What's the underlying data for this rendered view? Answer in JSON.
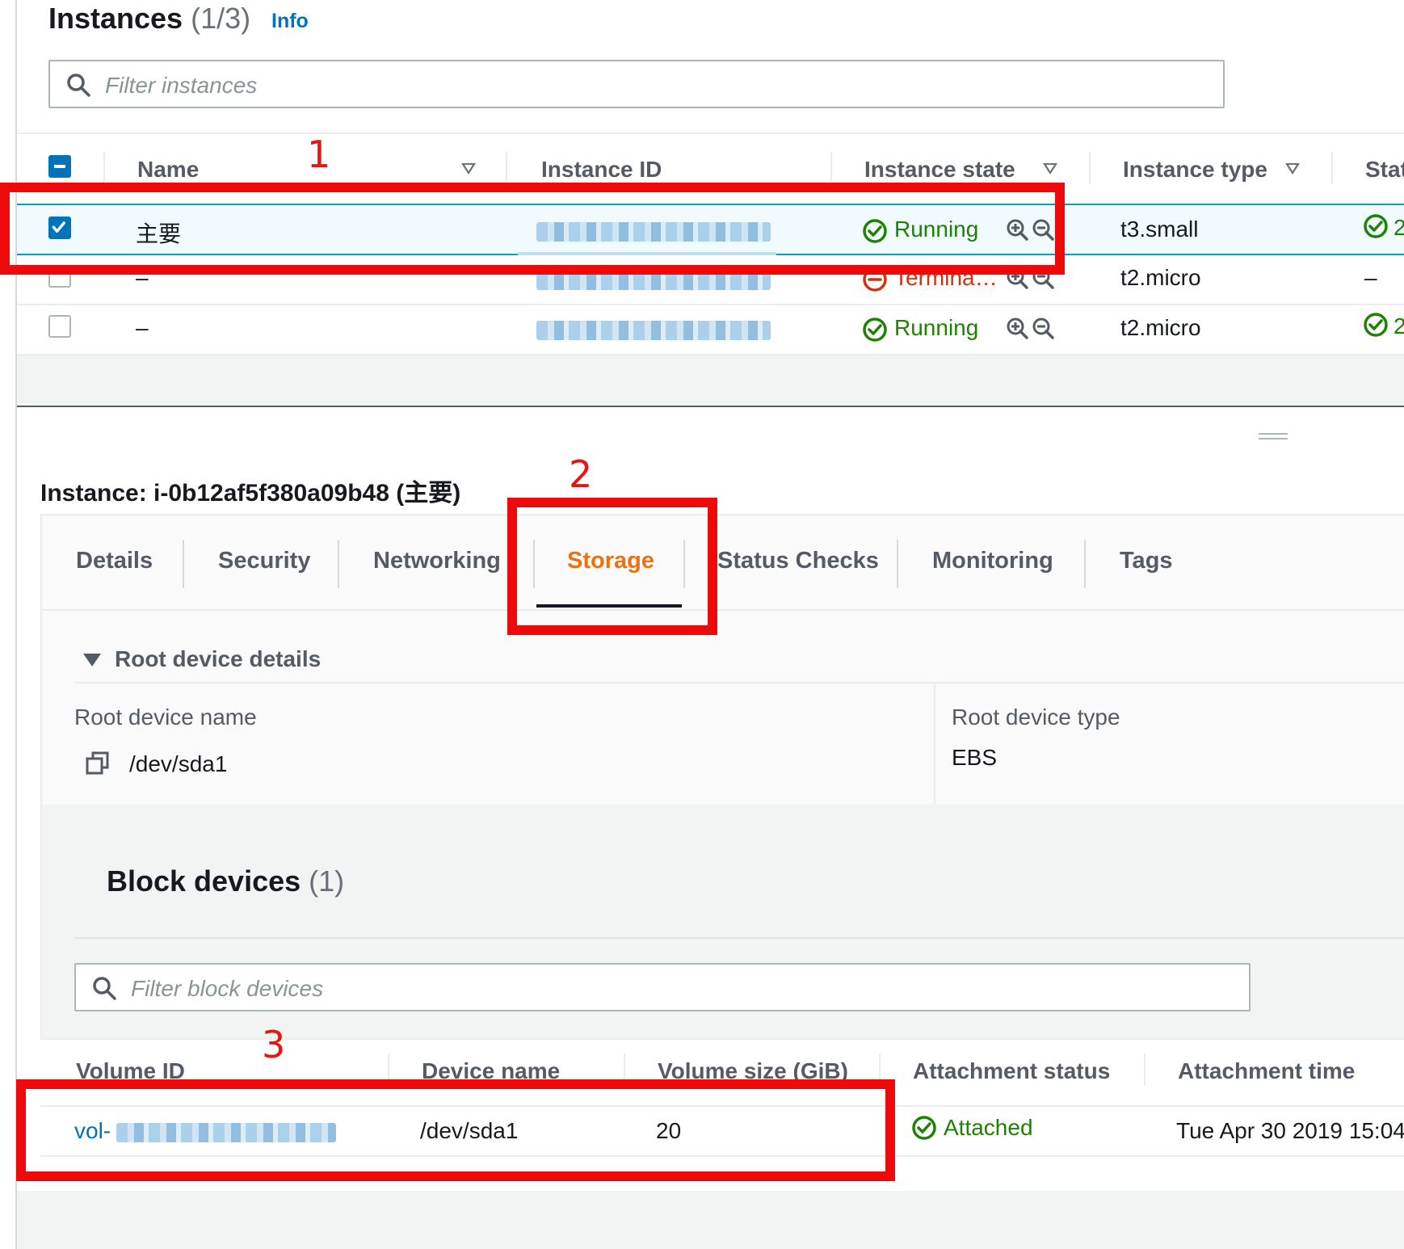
{
  "instances": {
    "title": "Instances",
    "count": "(1/3)",
    "info_label": "Info",
    "filter_placeholder": "Filter instances",
    "columns": {
      "name": "Name",
      "instance_id": "Instance ID",
      "instance_state": "Instance state",
      "instance_type": "Instance type",
      "status": "Stat"
    },
    "rows": [
      {
        "name": "主要",
        "state": "Running",
        "type": "t3.small",
        "status": "2",
        "selected": true
      },
      {
        "name": "–",
        "state": "Termina…",
        "type": "t2.micro",
        "status": "–",
        "selected": false
      },
      {
        "name": "–",
        "state": "Running",
        "type": "t2.micro",
        "status": "2",
        "selected": false
      }
    ]
  },
  "detail": {
    "heading": "Instance: i-0b12af5f380a09b48 (主要)",
    "tabs": [
      "Details",
      "Security",
      "Networking",
      "Storage",
      "Status Checks",
      "Monitoring",
      "Tags"
    ],
    "active_tab": "Storage",
    "root_device": {
      "section_title": "Root device details",
      "name_label": "Root device name",
      "name_value": "/dev/sda1",
      "type_label": "Root device type",
      "type_value": "EBS"
    },
    "block_devices": {
      "title": "Block devices",
      "count": "(1)",
      "filter_placeholder": "Filter block devices",
      "columns": {
        "volume_id": "Volume ID",
        "device_name": "Device name",
        "volume_size": "Volume size (GiB)",
        "attachment_status": "Attachment status",
        "attachment_time": "Attachment time"
      },
      "rows": [
        {
          "volume_prefix": "vol-",
          "device": "/dev/sda1",
          "size": "20",
          "status": "Attached",
          "time": "Tue Apr 30 2019 15:04"
        }
      ]
    }
  },
  "annotations": {
    "one": "1",
    "two": "2",
    "three": "3"
  },
  "colors": {
    "running": "#1d8102",
    "terminated": "#d13212",
    "link": "#0073bb",
    "active_tab": "#ec7211",
    "annotation": "#ee0a0a"
  }
}
